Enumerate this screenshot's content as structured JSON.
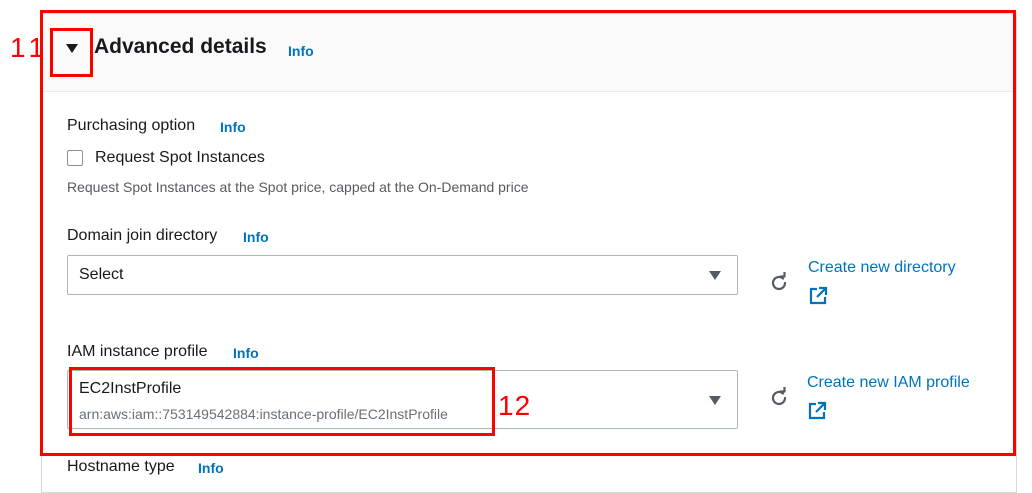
{
  "advanced": {
    "title": "Advanced details",
    "info": "Info"
  },
  "purchasing": {
    "label": "Purchasing option",
    "info": "Info",
    "checkbox_label": "Request Spot Instances",
    "description": "Request Spot Instances at the Spot price, capped at the On-Demand price",
    "checked": false
  },
  "domain_join": {
    "label": "Domain join directory",
    "info": "Info",
    "selected": "Select",
    "create_link": "Create new directory"
  },
  "iam_profile": {
    "label": "IAM instance profile",
    "info": "Info",
    "selected": "EC2InstProfile",
    "selected_arn": "arn:aws:iam::753149542884:instance-profile/EC2InstProfile",
    "create_link": "Create new IAM profile"
  },
  "hostname": {
    "label_partial": "Hostname type",
    "info_partial": "Info"
  },
  "annotations": {
    "marker_11": "11",
    "marker_12": "12"
  },
  "icons": {
    "expand": "caret-down-icon",
    "refresh": "refresh-icon",
    "external": "external-link-icon",
    "dropdown": "dropdown-caret-icon"
  },
  "colors": {
    "link": "#0073bb",
    "annotation": "#ff0000",
    "text": "#16191f",
    "muted": "#545b64"
  }
}
